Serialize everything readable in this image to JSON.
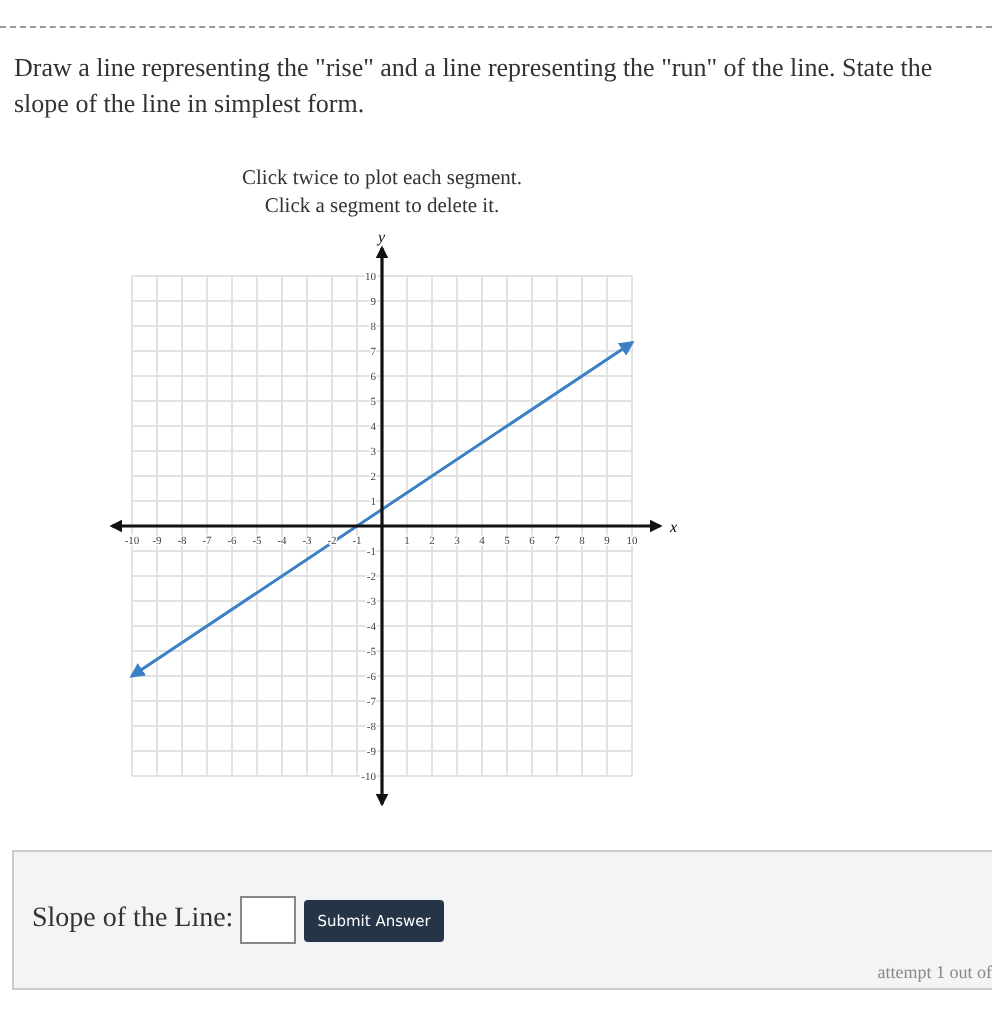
{
  "question": {
    "prompt": "Draw a line representing the \"rise\" and a line representing the \"run\" of the line. State the slope of the line in simplest form."
  },
  "graph": {
    "instructions": [
      "Click twice to plot each segment.",
      "Click a segment to delete it."
    ],
    "chart_data": {
      "type": "line",
      "xlabel": "x",
      "ylabel": "y",
      "x": [
        -10,
        10
      ],
      "series": [
        {
          "color": "#3b7fc4",
          "values": [
            -6,
            7.33
          ]
        }
      ],
      "grid": true,
      "xlim": [
        -10,
        10
      ],
      "ylim": [
        -10,
        10
      ],
      "xticks": [
        -10,
        -9,
        -8,
        -7,
        -6,
        -5,
        -4,
        -3,
        -2,
        -1,
        1,
        2,
        3,
        4,
        5,
        6,
        7,
        8,
        9,
        10
      ],
      "yticks": [
        -10,
        -9,
        -8,
        -7,
        -6,
        -5,
        -4,
        -3,
        -2,
        -1,
        1,
        2,
        3,
        4,
        5,
        6,
        7,
        8,
        9,
        10
      ]
    }
  },
  "answer": {
    "label": "Slope of the Line:",
    "button": "Submit Answer",
    "attempt": "attempt 1 out of"
  }
}
